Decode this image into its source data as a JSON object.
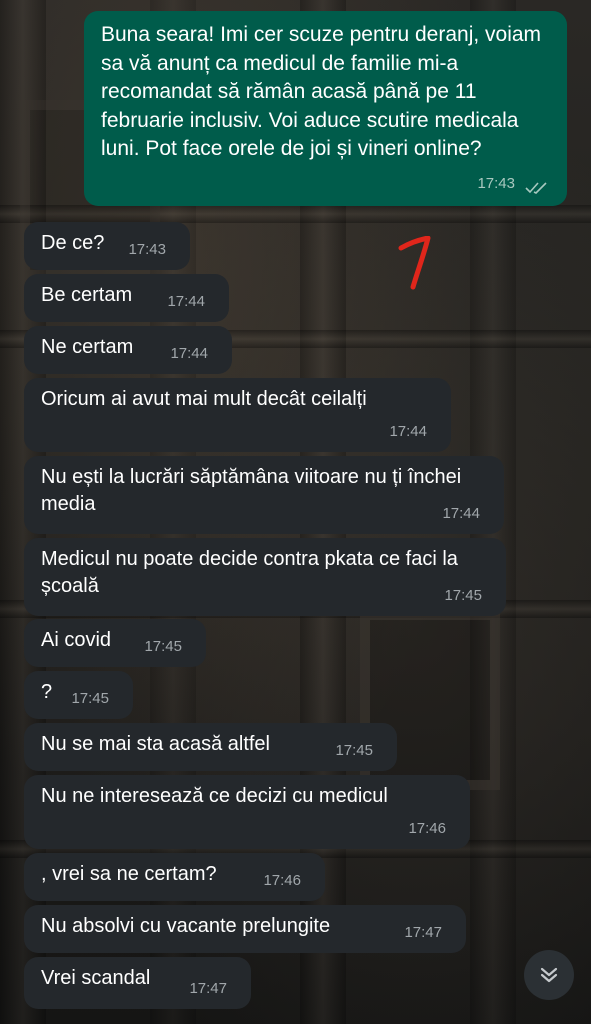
{
  "theme": {
    "incoming_bubble": "#24282c",
    "outgoing_bubble": "#005c4b",
    "text": "#ffffff",
    "timestamp": "#a1a7ab",
    "annotation_mark": "#e0261b"
  },
  "outgoing": {
    "text": "Buna seara! Imi cer scuze pentru deranj, voiam sa vă anunț ca medicul de familie mi-a recomandat să rămân acasă până pe 11 februarie inclusiv. Voi aduce scutire medicala luni. Pot face orele de joi și vineri online?",
    "time": "17:43",
    "status_icon": "double-check-icon"
  },
  "incoming": [
    {
      "text": "De ce?",
      "time": "17:43"
    },
    {
      "text": "Be certam",
      "time": "17:44"
    },
    {
      "text": "Ne certam",
      "time": "17:44"
    },
    {
      "text": "Oricum ai avut mai mult decât ceilalți",
      "time": "17:44"
    },
    {
      "text": "Nu ești la lucrări săptămâna viitoare nu ți închei media",
      "time": "17:44"
    },
    {
      "text": "Medicul nu poate decide contra pkata ce faci la școală",
      "time": "17:45"
    },
    {
      "text": "Ai covid",
      "time": "17:45"
    },
    {
      "text": "?",
      "time": "17:45"
    },
    {
      "text": "Nu se mai sta acasă altfel",
      "time": "17:45"
    },
    {
      "text": "Nu ne interesează ce decizi cu medicul",
      "time": "17:46"
    },
    {
      "text": ", vrei sa ne certam?",
      "time": "17:46"
    },
    {
      "text": "Nu absolvi cu vacante prelungite",
      "time": "17:47"
    },
    {
      "text": "Vrei scandal",
      "time": "17:47"
    }
  ],
  "annotation": {
    "icon": "red-mark-annotation"
  },
  "scroll_button": {
    "icon": "chevron-double-down-icon"
  }
}
